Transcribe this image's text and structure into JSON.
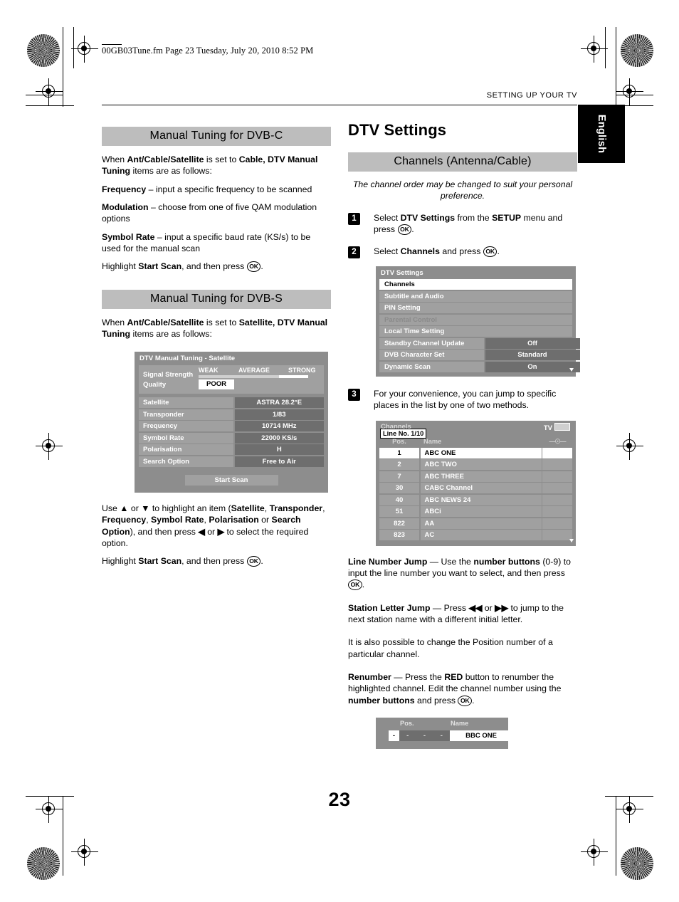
{
  "print": {
    "file_header": "00GB03Tune.fm  Page 23  Tuesday, July 20, 2010  8:52 PM",
    "running_head": "SETTING UP YOUR TV",
    "language_tab": "English",
    "page_number": "23"
  },
  "left_column": {
    "section_dvbc": {
      "heading": "Manual Tuning for DVB-C",
      "paragraphs": [
        "When <b>Ant/Cable/Satellite</b> is set to <b>Cable, DTV Manual Tuning</b> items are as follows:",
        "<b>Frequency</b> – input a specific frequency to be scanned",
        "<b>Modulation</b> – choose from one of five QAM modulation options",
        "<b>Symbol Rate</b> – input a specific baud rate (KS/s) to be used for the manual scan",
        "Highlight <b>Start Scan</b>, and then press <span class=\"okkey\">OK</span>."
      ]
    },
    "section_dvbs": {
      "heading": "Manual Tuning for DVB-S",
      "intro": "When <b>Ant/Cable/Satellite</b> is set to <b>Satellite, DTV Manual Tuning</b> items are as follows:",
      "outro": [
        "Use <b>▲</b> or <b>▼</b> to highlight an item (<b>Satellite</b>, <b>Transponder</b>, <b>Frequency</b>, <b>Symbol Rate</b>, <b>Polarisation</b> or <b>Search Option</b>), and then press <b>◀</b> or <b>▶</b> to select the required option.",
        "Highlight <b>Start Scan</b>, and then press <span class=\"okkey\">OK</span>."
      ]
    },
    "tuning_panel": {
      "title": "DTV Manual Tuning - Satellite",
      "signal_strength_label": "Signal Strength",
      "quality_label": "Quality",
      "scale": {
        "weak": "WEAK",
        "average": "AVERAGE",
        "strong": "STRONG"
      },
      "quality_value": "POOR",
      "rows": [
        {
          "label": "Satellite",
          "value": "ASTRA 28.2°E"
        },
        {
          "label": "Transponder",
          "value": "1/83"
        },
        {
          "label": "Frequency",
          "value": "10714 MHz"
        },
        {
          "label": "Symbol Rate",
          "value": "22000 KS/s"
        },
        {
          "label": "Polarisation",
          "value": "H"
        },
        {
          "label": "Search Option",
          "value": "Free to Air"
        }
      ],
      "start_scan": "Start Scan"
    }
  },
  "right_column": {
    "title": "DTV Settings",
    "section_heading": "Channels (Antenna/Cable)",
    "intro_italic": "The channel order may be changed to suit your personal preference.",
    "steps": [
      {
        "num": "1",
        "text": "Select <b>DTV Settings</b> from the <b>SETUP</b> menu and press <span class=\"okkey\">OK</span>."
      },
      {
        "num": "2",
        "text": "Select <b>Channels</b> and press <span class=\"okkey\">OK</span>."
      },
      {
        "num": "3",
        "text": "For your convenience, you can jump to specific places in the list by one of two methods."
      }
    ],
    "settings_panel": {
      "title": "DTV Settings",
      "items": [
        {
          "label": "Channels",
          "value": "",
          "state": "selected"
        },
        {
          "label": "Subtitle and Audio",
          "value": "",
          "state": "normal"
        },
        {
          "label": "PIN Setting",
          "value": "",
          "state": "normal"
        },
        {
          "label": "Parental Control",
          "value": "",
          "state": "disabled"
        },
        {
          "label": "Local Time Setting",
          "value": "",
          "state": "normal"
        },
        {
          "label": "Standby Channel Update",
          "value": "Off",
          "state": "normal"
        },
        {
          "label": "DVB Character Set",
          "value": "Standard",
          "state": "normal"
        },
        {
          "label": "Dynamic Scan",
          "value": "On",
          "state": "normal"
        }
      ]
    },
    "channels_panel": {
      "title": "Channels",
      "source_label": "TV",
      "line_no": "Line No. 1/10",
      "columns": {
        "pos": "Pos.",
        "name": "Name",
        "lock": "lock-icon"
      },
      "rows": [
        {
          "pos": "1",
          "name": "ABC ONE",
          "state": "selected"
        },
        {
          "pos": "2",
          "name": "ABC TWO",
          "state": "normal"
        },
        {
          "pos": "7",
          "name": "ABC THREE",
          "state": "normal"
        },
        {
          "pos": "30",
          "name": "CABC Channel",
          "state": "normal"
        },
        {
          "pos": "40",
          "name": "ABC NEWS 24",
          "state": "normal"
        },
        {
          "pos": "51",
          "name": "ABCi",
          "state": "normal"
        },
        {
          "pos": "822",
          "name": "AA",
          "state": "normal"
        },
        {
          "pos": "823",
          "name": "AC",
          "state": "normal"
        }
      ]
    },
    "jump_paragraphs": [
      "<b>Line Number Jump</b> — Use the <b>number buttons</b> (0-9) to input the line number you want to select, and then press <span class=\"okkey\">OK</span>.",
      "<b>Station Letter Jump</b> — Press <b>◀◀</b> or <b>▶▶</b> to jump to the next station name with a different initial letter.",
      "It is also possible to change the Position number of a particular channel.",
      "<b>Renumber</b> — Press the <b>RED</b> button to renumber the highlighted channel. Edit the channel number using the <b>number buttons</b> and press <span class=\"okkey\">OK</span>."
    ],
    "renumber_panel": {
      "pos_label": "Pos.",
      "name_label": "Name",
      "pos_first": "-",
      "pos_rest": "- - -",
      "channel_name": "BBC ONE"
    }
  },
  "colors": {
    "osd_background": "#8d8d8d",
    "osd_row": "#a0a0a0",
    "osd_value": "#6e6e6e",
    "section_bar": "#bdbdbd",
    "highlight": "#ffffff"
  }
}
